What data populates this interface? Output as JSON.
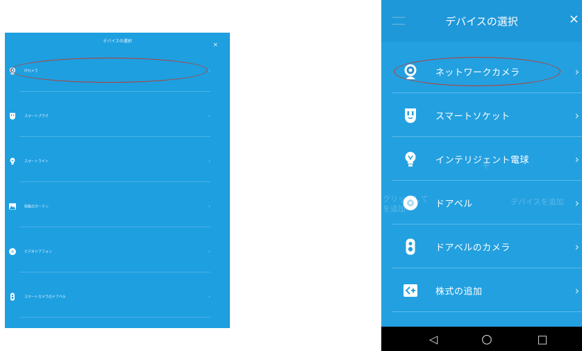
{
  "tablet": {
    "title": "デバイスの選択",
    "close": "×",
    "chevron": "›",
    "items": [
      {
        "label": "IPカメラ",
        "icon": "network-camera-icon"
      },
      {
        "label": "スマートプラグ",
        "icon": "smart-plug-icon"
      },
      {
        "label": "スマートライト",
        "icon": "light-bulb-icon"
      },
      {
        "label": "知能のカーテン",
        "icon": "curtain-icon"
      },
      {
        "label": "ビデオドアフォン",
        "icon": "doorbell-icon"
      },
      {
        "label": "スマートカメラのドアベル",
        "icon": "doorbell-camera-icon"
      }
    ]
  },
  "phone": {
    "title": "デバイスの選択",
    "close": "×",
    "chevron": "›",
    "items": [
      {
        "label": "ネットワークカメラ",
        "icon": "network-camera-icon"
      },
      {
        "label": "スマートソケット",
        "icon": "smart-socket-icon"
      },
      {
        "label": "インテリジェント電球",
        "icon": "light-bulb-icon"
      },
      {
        "label": "ドアベル",
        "icon": "doorbell-icon"
      },
      {
        "label": "ドアベルのカメラ",
        "icon": "doorbell-camera-icon"
      },
      {
        "label": "株式の追加",
        "icon": "add-share-icon"
      }
    ],
    "background_hint_left": "クリックして",
    "background_hint_left_line2": "を追加",
    "background_hint_right": "デバイスを追加",
    "nav": {
      "back": "◁",
      "home": "○",
      "recents": "□"
    }
  },
  "colors": {
    "accent_blue": "#23a0e0",
    "highlight_oval": "#c0392b",
    "nav_bar": "#000000"
  }
}
